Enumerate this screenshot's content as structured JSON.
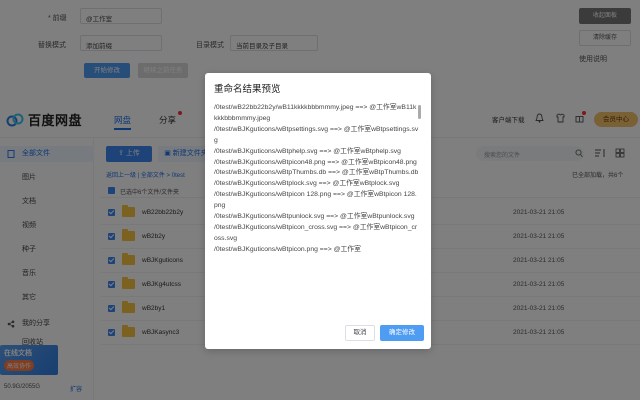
{
  "tool": {
    "prefix_label": "* 前缀",
    "prefix_value": "@工作室",
    "replace_mode_label": "替换模式",
    "replace_mode_value": "添加前缀",
    "dir_mode_label": "目录模式",
    "dir_mode_value": "当前目录及子目录",
    "start_button": "开始修改",
    "continue_button": "继续之前任务",
    "collapse_button": "收起面板",
    "clear_cache_button": "清除缓存",
    "help_link": "使用说明"
  },
  "header": {
    "logo_text": "百度网盘",
    "tab_files": "网盘",
    "tab_share": "分享",
    "client_download": "客户端下载",
    "vip_button": "会员中心"
  },
  "sidebar": {
    "items": [
      {
        "label": "全部文件",
        "active": true
      },
      {
        "label": "图片"
      },
      {
        "label": "文档"
      },
      {
        "label": "视频"
      },
      {
        "label": "种子"
      },
      {
        "label": "音乐"
      },
      {
        "label": "其它"
      },
      {
        "label": "我的分享"
      },
      {
        "label": "回收站"
      }
    ],
    "promo_title": "在线文档",
    "promo_badge": "高效协作",
    "quota": "50.9G/2055G",
    "quota_expand": "扩容"
  },
  "main": {
    "upload_button": "上传",
    "new_folder_button": "新建文件夹",
    "search_placeholder": "搜索您的文件",
    "crumbs": "返回上一级  |  全部文件 > 0test",
    "crumbs_status": "已全部加载，共6个",
    "selected_text": "已选中6个文件/文件夹",
    "rows": [
      {
        "name": "wB22bb22b2y",
        "date": "2021-03-21 21:05"
      },
      {
        "name": "wB2b2y",
        "date": "2021-03-21 21:05"
      },
      {
        "name": "wBJKguticons",
        "date": "2021-03-21 21:05"
      },
      {
        "name": "wBJKg4utcss",
        "date": "2021-03-21 21:05"
      },
      {
        "name": "wB2by1",
        "date": "2021-03-21 21:05"
      },
      {
        "name": "wBJKasync3",
        "date": "2021-03-21 21:05"
      }
    ]
  },
  "modal": {
    "title": "重命名结果预览",
    "lines": [
      "/0test/wB22bb22b2y/wB11kkkkbbbmmmy.jpeg ==> @工作室wB11kkkkbbbmmmy.jpeg",
      "/0test/wBJKguticons/wBtpsettings.svg ==> @工作室wBtpsettings.svg",
      "/0test/wBJKguticons/wBtphelp.svg ==> @工作室wBtphelp.svg",
      "/0test/wBJKguticons/wBtpicon48.png ==> @工作室wBtpicon48.png",
      "/0test/wBJKguticons/wBtpThumbs.db ==> @工作室wBtpThumbs.db",
      "/0test/wBJKguticons/wBtplock.svg ==> @工作室wBtplock.svg",
      "/0test/wBJKguticons/wBtpicon 128.png ==> @工作室wBtpicon 128.png",
      "/0test/wBJKguticons/wBtpunlock.svg ==> @工作室wBtpunlock.svg",
      "/0test/wBJKguticons/wBtpicon_cross.svg ==> @工作室wBtpicon_cross.svg",
      "/0test/wBJKguticons/wBtpicon.png ==> @工作室"
    ],
    "cancel_button": "取消",
    "confirm_button": "确定修改"
  }
}
